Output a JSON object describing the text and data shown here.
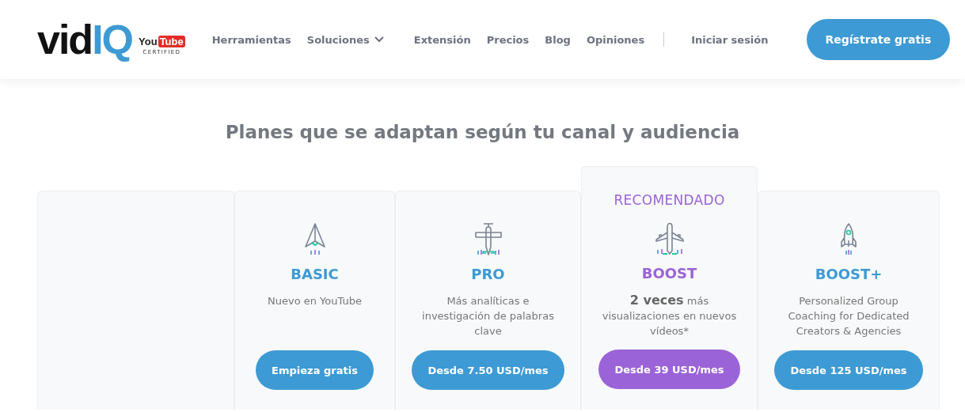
{
  "logo": {
    "text_dark": "vid",
    "text_accent": "IQ"
  },
  "certified_badge": {
    "you": "You",
    "tube": "Tube",
    "caption": "CERTIFIED"
  },
  "nav": [
    {
      "label": "Herramientas",
      "dropdown": false
    },
    {
      "label": "Soluciones",
      "dropdown": true
    },
    {
      "label": "Extensión",
      "dropdown": false
    },
    {
      "label": "Precios",
      "dropdown": false
    },
    {
      "label": "Blog",
      "dropdown": false
    },
    {
      "label": "Opiniones",
      "dropdown": false
    }
  ],
  "login": "Iniciar sesión",
  "signup_button": "Regístrate gratis",
  "heading": "Planes que se adaptan según tu canal y audiencia",
  "plans": [
    {
      "kind": "dart",
      "name": "BASIC",
      "color": "#3d9ad4",
      "recommended": false,
      "description": "Nuevo en YouTube",
      "button": "Empieza gratis"
    },
    {
      "kind": "propeller",
      "name": "PRO",
      "color": "#3d9ad4",
      "recommended": false,
      "description": "Más analíticas e investigación de palabras clave",
      "button": "Desde 7.50 USD/mes"
    },
    {
      "kind": "jet",
      "name": "BOOST",
      "color": "#9b63d8",
      "recommended": true,
      "badge": "RECOMENDADO",
      "description": "**2 veces** más visualizaciones en nuevos vídeos*",
      "button": "Desde 39 USD/mes"
    },
    {
      "kind": "rocket",
      "name": "BOOST+",
      "color": "#3d9ad4",
      "recommended": false,
      "description": "Personalized Group Coaching for Dedicated Creators & Agencies",
      "button": "Desde 125 USD/mes"
    }
  ]
}
